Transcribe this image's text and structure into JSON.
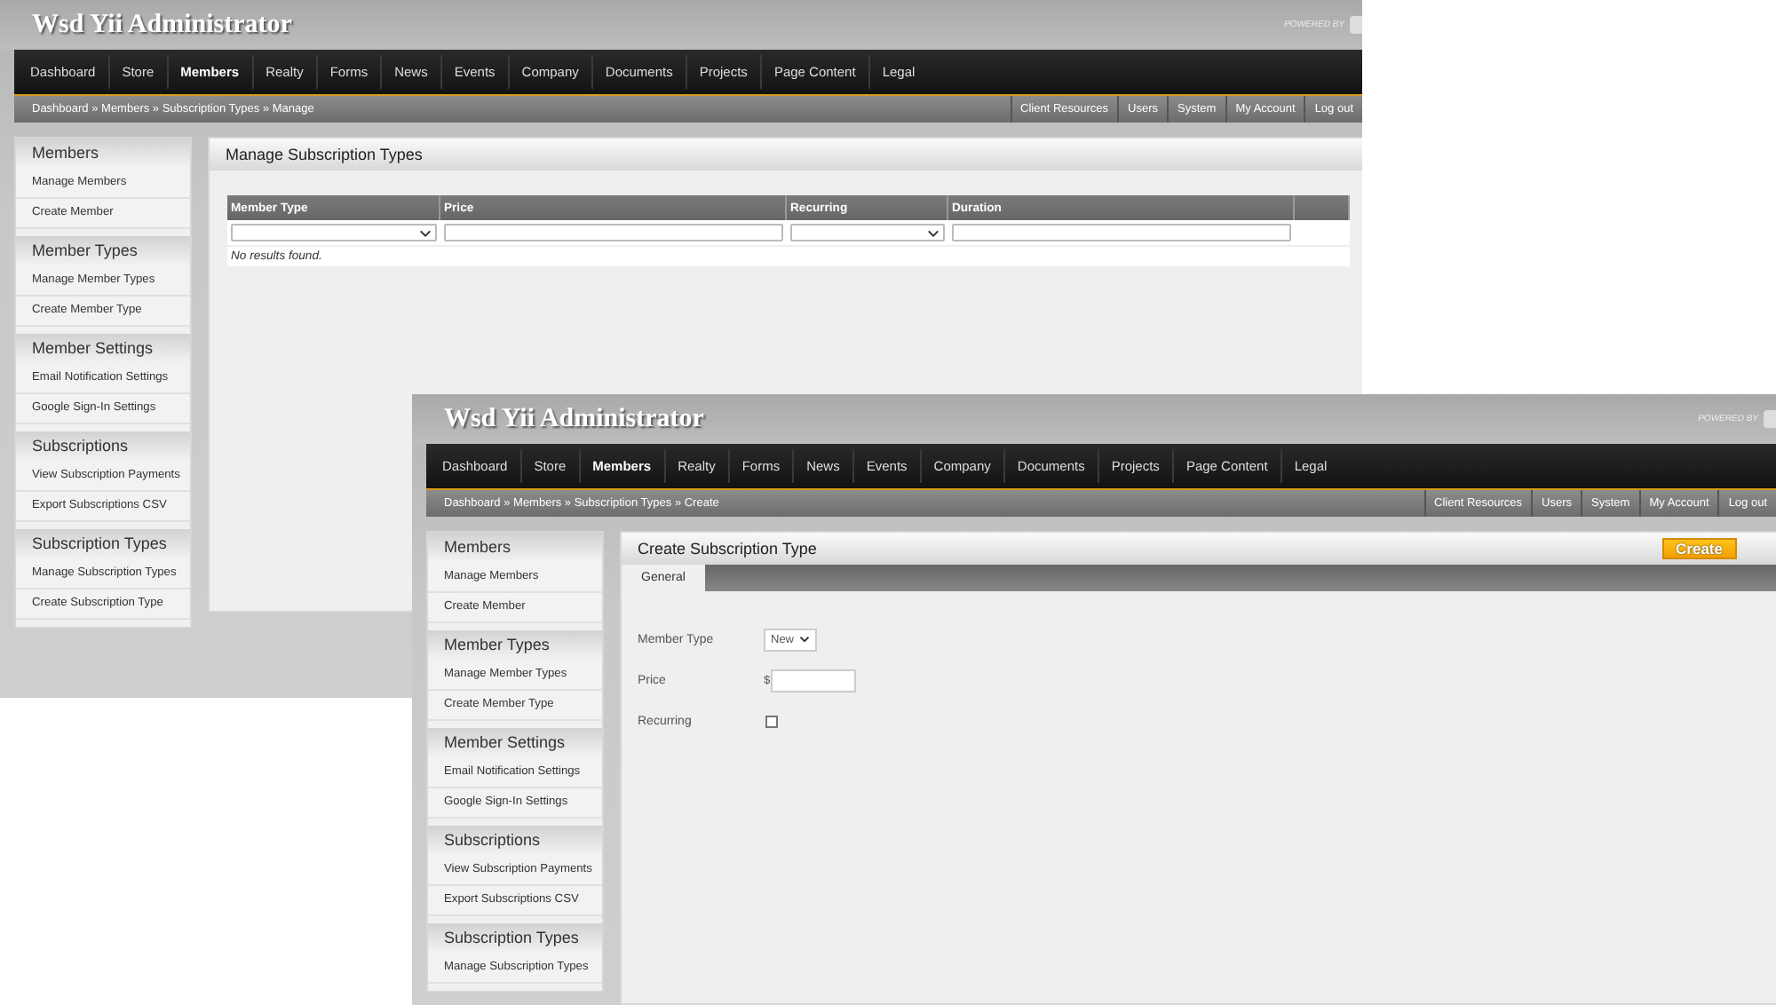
{
  "windows": [
    {
      "kind": "grid",
      "title": "Wsd Yii Administrator",
      "powered_by": "POWERED BY",
      "nav": [
        {
          "label": "Dashboard",
          "selected": false
        },
        {
          "label": "Store",
          "selected": false
        },
        {
          "label": "Members",
          "selected": true
        },
        {
          "label": "Realty",
          "selected": false
        },
        {
          "label": "Forms",
          "selected": false
        },
        {
          "label": "News",
          "selected": false
        },
        {
          "label": "Events",
          "selected": false
        },
        {
          "label": "Company",
          "selected": false
        },
        {
          "label": "Documents",
          "selected": false
        },
        {
          "label": "Projects",
          "selected": false
        },
        {
          "label": "Page Content",
          "selected": false
        },
        {
          "label": "Legal",
          "selected": false
        }
      ],
      "breadcrumb": "Dashboard » Members » Subscription Types » Manage",
      "top_links": [
        "Client Resources",
        "Users",
        "System",
        "My Account",
        "Log out"
      ],
      "sidebar": [
        {
          "title": "Members",
          "items": [
            "Manage Members",
            "Create Member"
          ]
        },
        {
          "title": "Member Types",
          "items": [
            "Manage Member Types",
            "Create Member Type"
          ]
        },
        {
          "title": "Member Settings",
          "items": [
            "Email Notification Settings",
            "Google Sign-In Settings"
          ]
        },
        {
          "title": "Subscriptions",
          "items": [
            "View Subscription Payments",
            "Export Subscriptions CSV"
          ]
        },
        {
          "title": "Subscription Types",
          "items": [
            "Manage Subscription Types",
            "Create Subscription Type"
          ]
        }
      ],
      "panel": {
        "title": "Manage Subscription Types",
        "columns": [
          "Member Type",
          "Price",
          "Recurring",
          "Duration"
        ],
        "filters": [
          {
            "kind": "select"
          },
          {
            "kind": "text"
          },
          {
            "kind": "select"
          },
          {
            "kind": "text"
          }
        ],
        "empty_text": "No results found."
      }
    },
    {
      "kind": "form",
      "title": "Wsd Yii Administrator",
      "powered_by": "POWERED BY",
      "nav": [
        {
          "label": "Dashboard",
          "selected": false
        },
        {
          "label": "Store",
          "selected": false
        },
        {
          "label": "Members",
          "selected": true
        },
        {
          "label": "Realty",
          "selected": false
        },
        {
          "label": "Forms",
          "selected": false
        },
        {
          "label": "News",
          "selected": false
        },
        {
          "label": "Events",
          "selected": false
        },
        {
          "label": "Company",
          "selected": false
        },
        {
          "label": "Documents",
          "selected": false
        },
        {
          "label": "Projects",
          "selected": false
        },
        {
          "label": "Page Content",
          "selected": false
        },
        {
          "label": "Legal",
          "selected": false
        }
      ],
      "breadcrumb": "Dashboard » Members » Subscription Types » Create",
      "top_links": [
        "Client Resources",
        "Users",
        "System",
        "My Account",
        "Log out"
      ],
      "sidebar": [
        {
          "title": "Members",
          "items": [
            "Manage Members",
            "Create Member"
          ]
        },
        {
          "title": "Member Types",
          "items": [
            "Manage Member Types",
            "Create Member Type"
          ]
        },
        {
          "title": "Member Settings",
          "items": [
            "Email Notification Settings",
            "Google Sign-In Settings"
          ]
        },
        {
          "title": "Subscriptions",
          "items": [
            "View Subscription Payments",
            "Export Subscriptions CSV"
          ]
        },
        {
          "title": "Subscription Types",
          "items": [
            "Manage Subscription Types"
          ]
        }
      ],
      "panel": {
        "title": "Create Subscription Type",
        "button": "Create",
        "tabs": [
          {
            "label": "General",
            "selected": true
          }
        ],
        "fields": [
          {
            "kind": "select",
            "label": "Member Type",
            "value": "New"
          },
          {
            "kind": "text",
            "label": "Price",
            "prefix": "$"
          },
          {
            "kind": "checkbox",
            "label": "Recurring",
            "checked": false
          }
        ]
      }
    }
  ]
}
